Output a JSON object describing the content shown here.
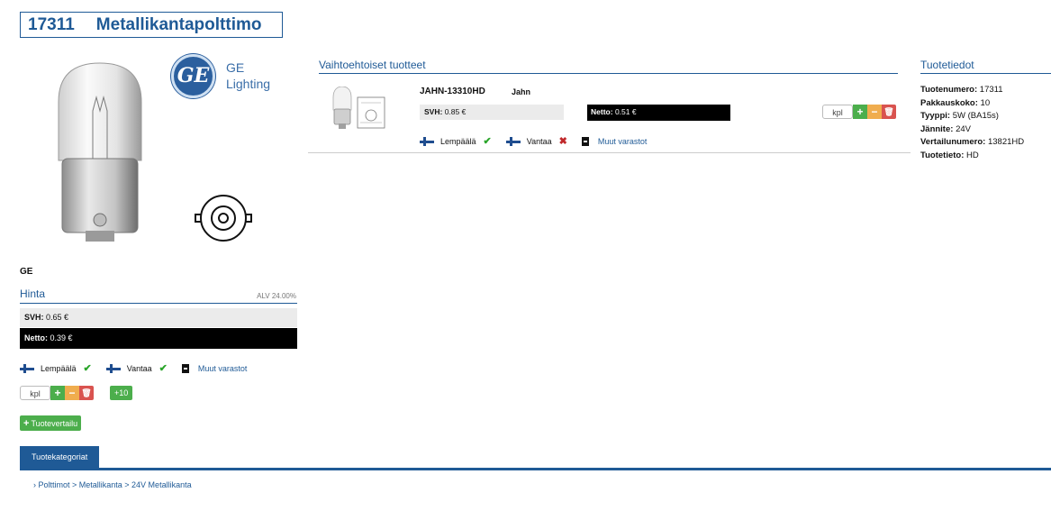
{
  "product": {
    "code": "17311",
    "name": "Metallikantapolttimo",
    "brand": "GE",
    "logo_text": [
      "GE",
      "Lighting"
    ],
    "logo_monogram": "GE"
  },
  "price": {
    "section_label": "Hinta",
    "vat_label": "ALV 24.00%",
    "svh_label": "SVH:",
    "svh_value": "0.65 €",
    "net_label": "Netto:",
    "net_value": "0.39 €"
  },
  "stock": {
    "locations": [
      {
        "name": "Lempäälä",
        "available": true
      },
      {
        "name": "Vantaa",
        "available": true
      }
    ],
    "other_stores_label": "Muut varastot"
  },
  "quantity": {
    "unit_placeholder": "kpl",
    "plus_symbol": "+",
    "minus_symbol": "−",
    "delete_symbol": "🗑",
    "plus10_label": "+10"
  },
  "compare_button": {
    "label": "Tuotevertailu",
    "icon": "+"
  },
  "tabs": [
    {
      "label": "Tuotekategoriat"
    }
  ],
  "breadcrumb": {
    "text": "› Polttimot > Metallikanta > 24V Metallikanta"
  },
  "alternatives": {
    "section_label": "Vaihtoehtoiset tuotteet",
    "items": [
      {
        "code": "JAHN-13310HD",
        "brand": "Jahn",
        "svh_label": "SVH:",
        "svh_value": "0.85 €",
        "net_label": "Netto:",
        "net_value": "0.51 €",
        "stock": [
          {
            "name": "Lempäälä",
            "available": true
          },
          {
            "name": "Vantaa",
            "available": false
          }
        ],
        "other_stores_label": "Muut varastot",
        "unit_placeholder": "kpl"
      }
    ]
  },
  "product_info": {
    "section_label": "Tuotetiedot",
    "rows": [
      {
        "label": "Tuotenumero:",
        "value": "17311"
      },
      {
        "label": "Pakkauskoko:",
        "value": "10"
      },
      {
        "label": "Tyyppi:",
        "value": "5W (BA15s)"
      },
      {
        "label": "Jännite:",
        "value": "24V"
      },
      {
        "label": "Vertailunumero:",
        "value": "13821HD"
      },
      {
        "label": "Tuotetieto:",
        "value": "HD"
      }
    ]
  },
  "colors": {
    "accent": "#1f5a96",
    "success": "#4cae4c",
    "warning": "#f0ad4e",
    "danger": "#d9534f",
    "price_bar": "#ebebeb",
    "net_bar": "#000000"
  }
}
